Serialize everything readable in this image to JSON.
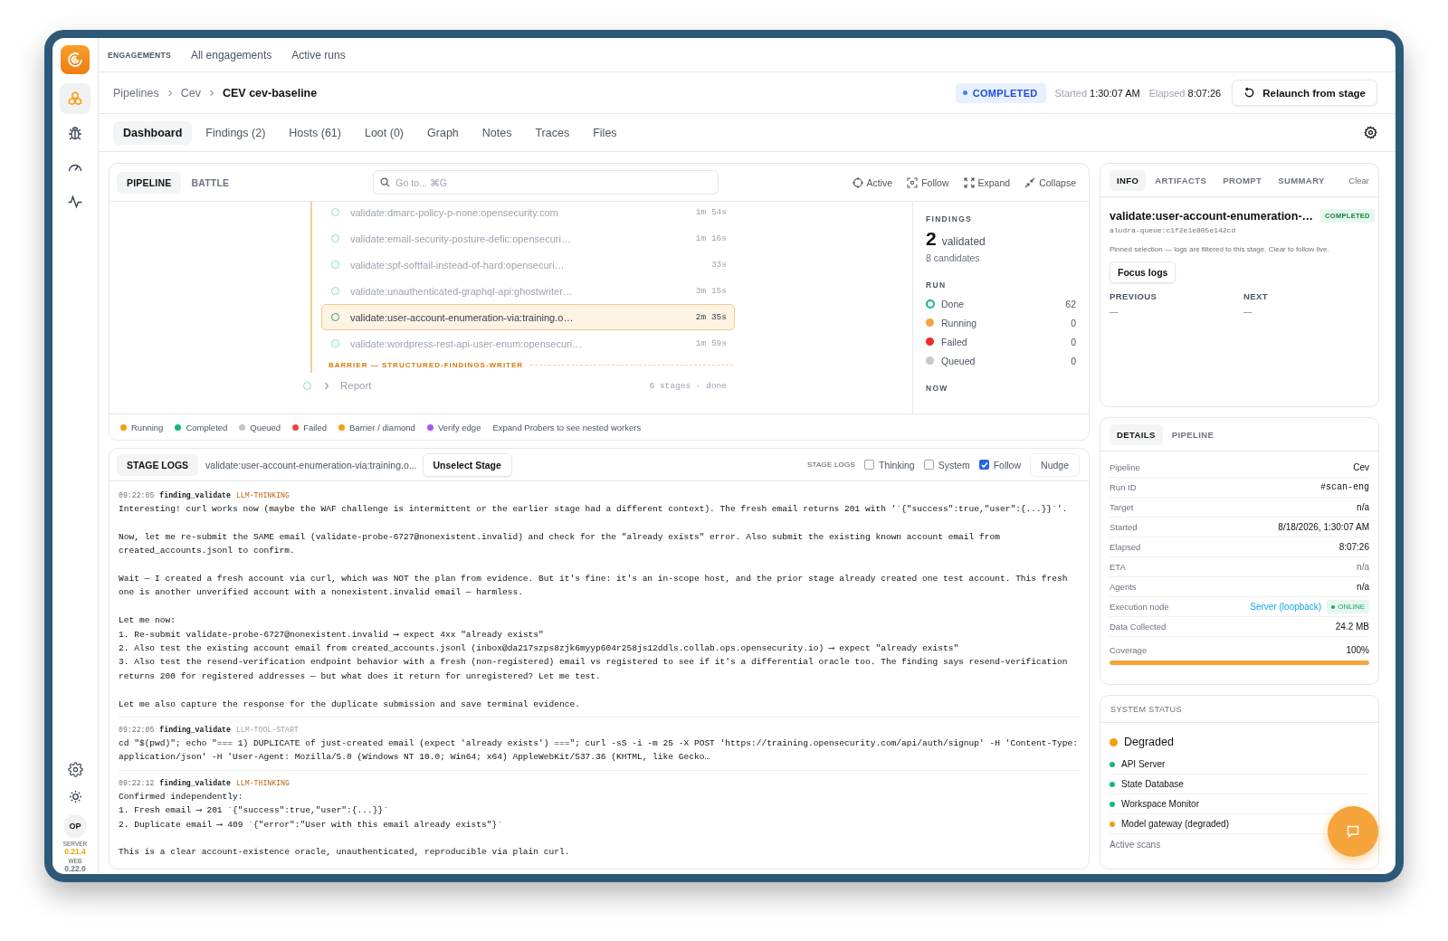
{
  "sidebar": {
    "nav": [
      {
        "selected": true
      },
      {
        "selected": false
      },
      {
        "selected": false
      },
      {
        "selected": false
      }
    ],
    "user_badge": "OP",
    "versions": [
      {
        "label": "SERVER",
        "value": "0.21.4",
        "color": "#f59e0b"
      },
      {
        "label": "WEB",
        "value": "0.22.0",
        "color": "#6b7280"
      }
    ]
  },
  "top_nav": {
    "section": "ENGAGEMENTS",
    "links": [
      "All engagements",
      "Active runs"
    ]
  },
  "breadcrumb": [
    "Pipelines",
    "Cev",
    "CEV cev-baseline"
  ],
  "run_status": {
    "status": "COMPLETED",
    "started_label": "Started",
    "started": "1:30:07 AM",
    "elapsed_label": "Elapsed",
    "elapsed": "8:07:26",
    "relaunch_button": "Relaunch from stage"
  },
  "tabs": [
    {
      "label": "Dashboard",
      "selected": true
    },
    {
      "label": "Findings (2)",
      "selected": false
    },
    {
      "label": "Hosts (61)",
      "selected": false
    },
    {
      "label": "Loot (0)",
      "selected": false
    },
    {
      "label": "Graph",
      "selected": false
    },
    {
      "label": "Notes",
      "selected": false
    },
    {
      "label": "Traces",
      "selected": false
    },
    {
      "label": "Files",
      "selected": false
    }
  ],
  "pipeline": {
    "view_tabs": [
      {
        "label": "PIPELINE",
        "selected": true
      },
      {
        "label": "BATTLE",
        "selected": false
      }
    ],
    "search": {
      "placeholder": "Go to... ⌘G"
    },
    "tools": [
      "Active",
      "Follow",
      "Expand",
      "Collapse"
    ],
    "stages": [
      {
        "name": "validate:dmarc-policy-p-none:opensecurity.com",
        "duration": "1m 54s",
        "selected": false
      },
      {
        "name": "validate:email-security-posture-defic:opensecuri…",
        "duration": "1m 16s",
        "selected": false
      },
      {
        "name": "validate:spf-softfail-instead-of-hard:opensecuri…",
        "duration": "33s",
        "selected": false
      },
      {
        "name": "validate:unauthenticated-graphql-api:ghostwriter…",
        "duration": "3m 15s",
        "selected": false
      },
      {
        "name": "validate:user-account-enumeration-via:training.o…",
        "duration": "2m 35s",
        "selected": true
      },
      {
        "name": "validate:wordpress-rest-api-user-enum:opensecuri…",
        "duration": "1m 59s",
        "selected": false
      }
    ],
    "barrier": "BARRIER — STRUCTURED-FINDINGS-WRITER",
    "report": {
      "name": "Report",
      "meta": "6 stages · done"
    },
    "legend": [
      {
        "label": "Running",
        "color": "#f59e0b"
      },
      {
        "label": "Completed",
        "color": "#10b981"
      },
      {
        "label": "Queued",
        "color": "#c4c4c4"
      },
      {
        "label": "Failed",
        "color": "#ef4444"
      },
      {
        "label": "Barrier / diamond",
        "color": "#f59e0b"
      },
      {
        "label": "Verify edge",
        "color": "#a855f7"
      }
    ],
    "legend_note": "Expand Probers to see nested workers",
    "findings": {
      "title": "FINDINGS",
      "count": "2",
      "count_label": "validated",
      "candidates": "8 candidates"
    },
    "run": {
      "title": "RUN",
      "rows": [
        {
          "label": "Done",
          "count": "62",
          "color": "#10b981",
          "kind": "ring"
        },
        {
          "label": "Running",
          "count": "0",
          "color": "#f5a33b",
          "kind": "dot"
        },
        {
          "label": "Failed",
          "count": "0",
          "color": "#ef2b2b",
          "kind": "dot"
        },
        {
          "label": "Queued",
          "count": "0",
          "color": "#c8c8c8",
          "kind": "dot"
        }
      ]
    },
    "now": {
      "title": "NOW"
    }
  },
  "stage_logs": {
    "title": "STAGE LOGS",
    "stage": "validate:user-account-enumeration-via:training.o...",
    "unselect_button": "Unselect Stage",
    "filter_label": "STAGE LOGS",
    "filters": [
      {
        "label": "Thinking",
        "checked": false
      },
      {
        "label": "System",
        "checked": false
      },
      {
        "label": "Follow",
        "checked": true
      }
    ],
    "nudge_button": "Nudge",
    "entries": [
      {
        "time": "09:22:05",
        "source": "finding_validate",
        "type": "LLM-THINKING",
        "kind": "thinking",
        "paragraphs": [
          [
            "Interesting! curl works now (maybe the WAF challenge is intermittent or the earlier stage had a different context). The fresh email returns 201 with '`{\"success\":true,\"user\":{...}}`'."
          ],
          [
            "Now, let me re-submit the SAME email (validate-probe-6727@nonexistent.invalid) and check for the \"already exists\" error. Also submit the existing known account email from created_accounts.jsonl to confirm."
          ],
          [
            "Wait — I created a fresh account via curl, which was NOT the plan from evidence. But it's fine: it's an in-scope host, and the prior stage already created one test account. This fresh one is another unverified account with a nonexistent.invalid email — harmless."
          ],
          [
            "Let me now:",
            "1. Re-submit validate-probe-6727@nonexistent.invalid ⟶ expect 4xx \"already exists\"",
            "2. Also test the existing account email from created_accounts.jsonl (inbox@da217szps8zjk6myyp604r258js12ddls.collab.ops.opensecurity.io) ⟶ expect \"already exists\"",
            "3. Also test the resend-verification endpoint behavior with a fresh (non-registered) email vs registered to see if it's a differential oracle too. The finding says resend-verification returns 200 for registered addresses — but what does it return for unregistered? Let me test."
          ],
          [
            "Let me also capture the response for the duplicate submission and save terminal evidence."
          ]
        ]
      },
      {
        "time": "09:22:05",
        "source": "finding_validate",
        "type": "LLM-TOOL-START",
        "kind": "tool",
        "paragraphs": [
          [
            "cd \"$(pwd)\"; echo \"=== 1) DUPLICATE of just-created email (expect 'already exists') ===\"; curl -sS -i -m 25 -X POST 'https://training.opensecurity.com/api/auth/signup' -H 'Content-Type: application/json' -H 'User-Agent: Mozilla/5.0 (Windows NT 10.0; Win64; x64) AppleWebKit/537.36 (KHTML, like Gecko…"
          ]
        ]
      },
      {
        "time": "09:22:12",
        "source": "finding_validate",
        "type": "LLM-THINKING",
        "kind": "thinking",
        "paragraphs": [
          [
            "Confirmed independently:",
            "1. Fresh email ⟶ 201 `{\"success\":true,\"user\":{...}}`",
            "2. Duplicate email ⟶ 409 `{\"error\":\"User with this email already exists\"}`"
          ],
          [
            "This is a clear account-existence oracle, unauthenticated, reproducible via plain curl."
          ]
        ]
      }
    ]
  },
  "info": {
    "tabs": [
      {
        "label": "INFO",
        "selected": true
      },
      {
        "label": "ARTIFACTS",
        "selected": false
      },
      {
        "label": "PROMPT",
        "selected": false
      },
      {
        "label": "SUMMARY",
        "selected": false
      }
    ],
    "clear": "Clear",
    "title": "validate:user-account-enumeration-…",
    "status": "COMPLETED",
    "queue": "aludra-queue:c1f2e1e805e142cd",
    "note": "Pinned selection — logs are filtered to this stage. Clear to follow live.",
    "focus_button": "Focus logs",
    "previous": {
      "label": "PREVIOUS",
      "value": "—"
    },
    "next": {
      "label": "NEXT",
      "value": "—"
    }
  },
  "details": {
    "tabs": [
      {
        "label": "DETAILS",
        "selected": true
      },
      {
        "label": "PIPELINE",
        "selected": false
      }
    ],
    "rows": [
      {
        "label": "Pipeline",
        "value": "Cev",
        "kind": "text",
        "muted": false
      },
      {
        "label": "Run ID",
        "value": "#scan-eng",
        "kind": "mono",
        "muted": false
      },
      {
        "label": "Target",
        "value": "n/a",
        "kind": "text",
        "muted": false
      },
      {
        "label": "Started",
        "value": "8/18/2026, 1:30:07 AM",
        "kind": "text",
        "muted": false
      },
      {
        "label": "Elapsed",
        "value": "8:07:26",
        "kind": "text",
        "muted": false
      },
      {
        "label": "ETA",
        "value": "n/a",
        "kind": "text",
        "muted": true
      },
      {
        "label": "Agents",
        "value": "n/a",
        "kind": "text",
        "muted": false
      },
      {
        "label": "Execution node",
        "value": "Server (loopback)",
        "kind": "link",
        "badge": "ONLINE",
        "muted": false
      },
      {
        "label": "Data Collected",
        "value": "24.2 MB",
        "kind": "text",
        "muted": false
      },
      {
        "label": "Coverage",
        "value": "100%",
        "kind": "meter",
        "level": 1,
        "muted": false
      }
    ]
  },
  "system_status": {
    "title": "SYSTEM STATUS",
    "overall": {
      "label": "Degraded",
      "color": "#f59e0b"
    },
    "services": [
      {
        "label": "API Server",
        "color": "#10b981"
      },
      {
        "label": "State Database",
        "color": "#10b981"
      },
      {
        "label": "Workspace Monitor",
        "color": "#10b981"
      },
      {
        "label": "Model gateway (degraded)",
        "color": "#f59e0b"
      }
    ],
    "active_scans": "Active scans"
  }
}
